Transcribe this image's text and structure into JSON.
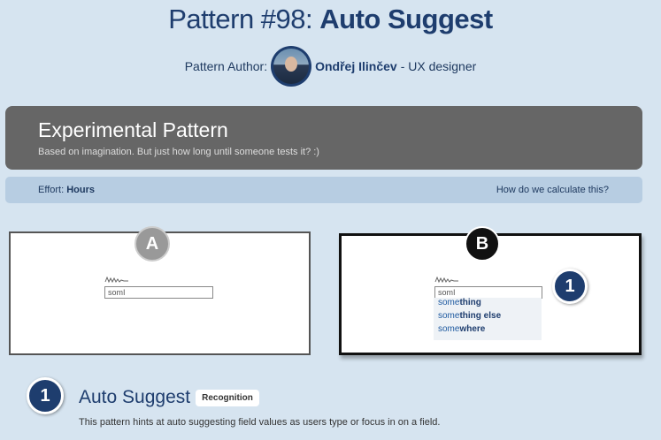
{
  "header": {
    "title_prefix": "Pattern #98: ",
    "title_bold": "Auto Suggest"
  },
  "author": {
    "label": "Pattern Author:",
    "name": "Ondřej Ilinčev",
    "role": " - UX designer"
  },
  "experimental": {
    "title": "Experimental Pattern",
    "subtitle": "Based on imagination. But just how long until someone tests it? :)"
  },
  "effort": {
    "label": "Effort: ",
    "value": "Hours",
    "link": "How do we calculate this?"
  },
  "variantA": {
    "badge": "A",
    "field_value": "somI"
  },
  "variantB": {
    "badge": "B",
    "field_value": "somI",
    "marker": "1",
    "suggestions": [
      {
        "prefix": "some",
        "rest": "thing"
      },
      {
        "prefix": "some",
        "rest": "thing else"
      },
      {
        "prefix": "some",
        "rest": "where"
      }
    ]
  },
  "section": {
    "number": "1",
    "title": "Auto Suggest",
    "tag": "Recognition",
    "description": "This pattern hints at auto suggesting field values as users type or focus in on a field."
  }
}
